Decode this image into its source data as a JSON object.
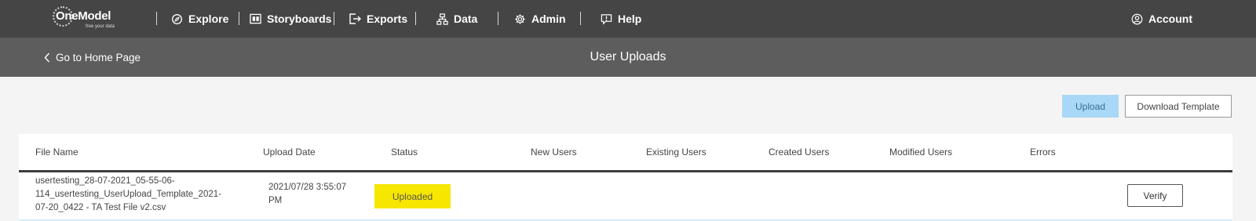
{
  "nav": {
    "logo_text": "OneModel",
    "logo_tagline": "free your data",
    "items": [
      {
        "label": "Explore",
        "icon": "explore-icon"
      },
      {
        "label": "Storyboards",
        "icon": "storyboards-icon"
      },
      {
        "label": "Exports",
        "icon": "exports-icon"
      },
      {
        "label": "Data",
        "icon": "data-icon"
      },
      {
        "label": "Admin",
        "icon": "gear-icon"
      },
      {
        "label": "Help",
        "icon": "help-icon"
      }
    ],
    "account_label": "Account"
  },
  "subheader": {
    "back_label": "Go to Home Page",
    "title": "User Uploads"
  },
  "actions": {
    "upload_label": "Upload",
    "download_template_label": "Download Template"
  },
  "table": {
    "columns": [
      "File Name",
      "Upload Date",
      "Status",
      "New Users",
      "Existing Users",
      "Created Users",
      "Modified Users",
      "Errors"
    ],
    "rows": [
      {
        "file_name_line1": "usertesting_28-07-2021_05-55-06-",
        "file_name_line2": "114_usertesting_UserUpload_Template_2021-",
        "file_name_line3": "07-20_0422 - TA Test File v2.csv",
        "upload_date_line1": "2021/07/28 3:55:07",
        "upload_date_line2": "PM",
        "status": "Uploaded",
        "new_users": "",
        "existing_users": "",
        "created_users": "",
        "modified_users": "",
        "errors": "",
        "action_label": "Verify"
      }
    ]
  },
  "colors": {
    "topnav_bg": "#454545",
    "subheader_bg": "#5d5d5d",
    "upload_button": "#a8d8f5",
    "status_uploaded": "#f6e600"
  }
}
